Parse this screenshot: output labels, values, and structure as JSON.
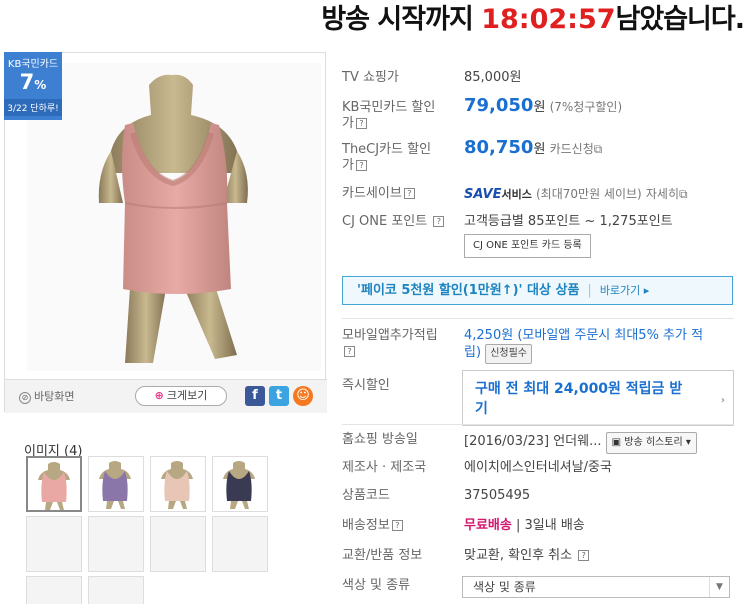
{
  "countdown": {
    "prefix": "방송 시작까지",
    "time": "18:02:57",
    "suffix": "남았습니다."
  },
  "kb_badge": {
    "card": "KB국민카드",
    "rate": "7",
    "rate_unit": "%",
    "period": "3/22 단하루!"
  },
  "image_tools": {
    "background": "바탕화면",
    "zoom": "크게보기",
    "share_icons": [
      "facebook-icon",
      "twitter-icon",
      "me2day-icon"
    ]
  },
  "thumbs": {
    "title": "이미지 (4)",
    "colors": [
      "#e9a8a3",
      "#8a76a8",
      "#e7c6b6",
      "#3a3a52"
    ]
  },
  "info": {
    "tv_price": {
      "label": "TV 쇼핑가",
      "value": "85,000원"
    },
    "kb_price": {
      "label_line1": "KB국민카드 할인",
      "label_line2": "가",
      "value": "79,050",
      "unit": "원",
      "note": "(7%청구할인)"
    },
    "cj_price": {
      "label_line1": "TheCJ카드 할인",
      "label_line2": "가",
      "value": "80,750",
      "unit": "원",
      "note": "카드신청"
    },
    "card_save": {
      "label": "카드세이브",
      "brand": "SAVE",
      "service": "서비스",
      "note": "(최대70만원 세이브)",
      "link": "자세히"
    },
    "cj_one": {
      "label": "CJ ONE 포인트",
      "value": "고객등급별 85포인트 ~ 1,275포인트",
      "button": "CJ ONE 포인트 카드 등록"
    },
    "payco": {
      "text": "'페이코 5천원 할인(1만원↑)' 대상 상품",
      "link": "바로가기"
    },
    "mobile": {
      "label": "모바일앱추가적립",
      "value": "4,250원",
      "note_line1": "(모바일앱 주문시 최대5% 추가 적",
      "note_line2": "립)",
      "tag": "신청필수"
    },
    "instant": {
      "label": "즉시할인",
      "line1": "구매 전 최대 24,000원 적립금 받",
      "line2": "기"
    },
    "broadcast": {
      "label": "홈쇼핑 방송일",
      "value": "[2016/03/23] 언더웨...",
      "button": "방송 히스토리"
    },
    "maker": {
      "label": "제조사 · 제조국",
      "value": "에이치에스인터네셔날/중국"
    },
    "code": {
      "label": "상품코드",
      "value": "37505495"
    },
    "shipping": {
      "label": "배송정보",
      "free": "무료배송",
      "note": "3일내 배송"
    },
    "exchange": {
      "label": "교환/반품 정보",
      "value": "맞교환, 확인후 취소"
    },
    "option": {
      "label": "색상 및 종류",
      "select_value": "색상 및 종류"
    }
  }
}
